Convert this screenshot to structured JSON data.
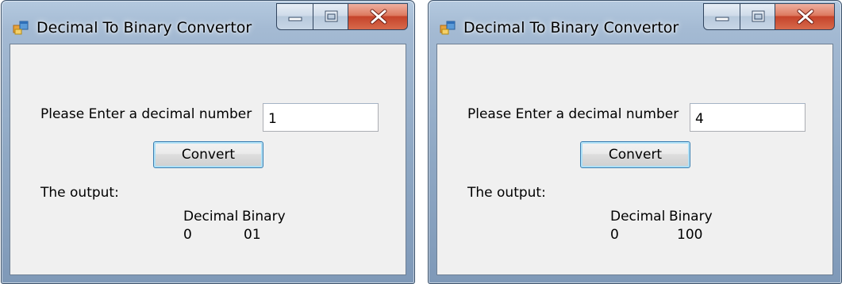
{
  "windows": [
    {
      "title": "Decimal To Binary Convertor",
      "prompt_label": "Please Enter a decimal number",
      "input_value": "1",
      "convert_label": "Convert",
      "output_label": "The output:",
      "column_decimal": "Decimal",
      "column_binary": "Binary",
      "decimal_value": "0",
      "binary_value": "01",
      "icons": {
        "app": "app-form-icon",
        "minimize": "minimize-icon",
        "maximize": "maximize-icon",
        "close": "close-icon"
      }
    },
    {
      "title": "Decimal To Binary Convertor",
      "prompt_label": "Please Enter a decimal number",
      "input_value": "4",
      "convert_label": "Convert",
      "output_label": "The output:",
      "column_decimal": "Decimal",
      "column_binary": "Binary",
      "decimal_value": "0",
      "binary_value": "100",
      "icons": {
        "app": "app-form-icon",
        "minimize": "minimize-icon",
        "maximize": "maximize-icon",
        "close": "close-icon"
      }
    }
  ],
  "colors": {
    "frame": "#8fa8c4",
    "client_background": "#f0f0f0",
    "close_button": "#c5432a",
    "focus_button_border": "#3c7fb1"
  }
}
